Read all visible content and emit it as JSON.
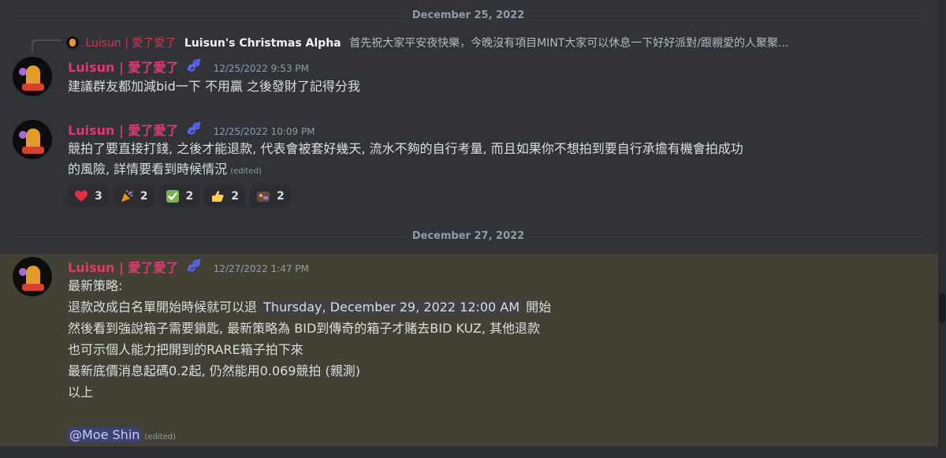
{
  "dividers": {
    "first": "December 25, 2022",
    "second": "December 27, 2022"
  },
  "reply": {
    "author": "Luisun | 愛了愛了",
    "title": "Luisun's Christmas Alpha",
    "snippet": "首先祝大家平安夜快樂，今晚沒有項目MINT大家可以休息一下好好派對/跟親愛的人聚聚..."
  },
  "messages": [
    {
      "author": "Luisun | 愛了愛了",
      "timestamp": "12/25/2022 9:53 PM",
      "lines": [
        "建議群友都加減bid一下 不用贏 之後發財了記得分我"
      ]
    },
    {
      "author": "Luisun | 愛了愛了",
      "timestamp": "12/25/2022 10:09 PM",
      "lines": [
        "競拍了要直接打錢, 之後才能退款, 代表會被套好幾天, 流水不夠的自行考量, 而且如果你不想拍到要自行承擔有機會拍成功",
        "的風險, 詳情要看到時候情況"
      ],
      "edited": "(edited)",
      "reactions": [
        {
          "icon": "heart-icon",
          "count": "3"
        },
        {
          "icon": "party-popper-icon",
          "count": "2"
        },
        {
          "icon": "check-mark-icon",
          "count": "2"
        },
        {
          "icon": "thumbs-up-icon",
          "count": "2"
        },
        {
          "icon": "custom-emoji-icon",
          "count": "2"
        }
      ]
    },
    {
      "author": "Luisun | 愛了愛了",
      "timestamp": "12/27/2022 1:47 PM",
      "line1": "最新策略:",
      "line2_pre": "退款改成白名單開始時候就可以退",
      "line2_time": "Thursday, December 29, 2022 12:00 AM",
      "line2_post": "開始",
      "line3": "然後看到強說箱子需要鎖匙, 最新策略為 BID到傳奇的箱子才賭去BID KUZ, 其他退款",
      "line4": "也可示個人能力把開到的RARE箱子拍下來",
      "line5": "最新底價消息起碼0.2起, 仍然能用0.069競拍 (親測)",
      "line6": "以上",
      "mention": "@Moe Shin",
      "edited": "(edited)"
    }
  ],
  "colors": {
    "background": "#313338",
    "username": "#e4366f",
    "highlight": "#434036",
    "timestamp": "#949ba4"
  }
}
